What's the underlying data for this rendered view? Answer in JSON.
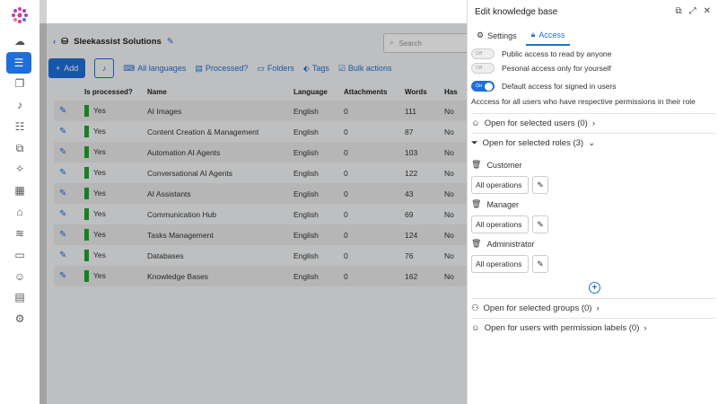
{
  "sidebar": {
    "items": [
      {
        "icon": "brain-icon"
      },
      {
        "icon": "database-icon"
      },
      {
        "icon": "gallery-icon"
      },
      {
        "icon": "microphone-icon"
      },
      {
        "icon": "checklist-icon"
      },
      {
        "icon": "copy-icon"
      },
      {
        "icon": "sparkle-icon"
      },
      {
        "icon": "chart-icon"
      },
      {
        "icon": "bank-icon"
      },
      {
        "icon": "stack-icon"
      },
      {
        "icon": "chat-icon"
      },
      {
        "icon": "users-icon"
      },
      {
        "icon": "server-icon"
      },
      {
        "icon": "gear-icon"
      }
    ]
  },
  "header": {
    "breadcrumb": "Sleekassist Solutions",
    "search_placeholder": "Search"
  },
  "toolbar": {
    "add_label": "Add",
    "all_languages": "All languages",
    "processed": "Processed?",
    "folders": "Folders",
    "tags": "Tags",
    "bulk_actions": "Bulk actions"
  },
  "table": {
    "columns": [
      "",
      "Is processed?",
      "Name",
      "Language",
      "Attachments",
      "Words",
      "Has"
    ],
    "rows": [
      {
        "processed": "Yes",
        "name": "AI Images",
        "language": "English",
        "attachments": "0",
        "words": "111",
        "has": "No"
      },
      {
        "processed": "Yes",
        "name": "Content Creation & Management",
        "language": "English",
        "attachments": "0",
        "words": "87",
        "has": "No"
      },
      {
        "processed": "Yes",
        "name": "Automation AI Agents",
        "language": "English",
        "attachments": "0",
        "words": "103",
        "has": "No"
      },
      {
        "processed": "Yes",
        "name": "Conversational AI Agents",
        "language": "English",
        "attachments": "0",
        "words": "122",
        "has": "No"
      },
      {
        "processed": "Yes",
        "name": "AI Assistants",
        "language": "English",
        "attachments": "0",
        "words": "43",
        "has": "No"
      },
      {
        "processed": "Yes",
        "name": "Communication Hub",
        "language": "English",
        "attachments": "0",
        "words": "69",
        "has": "No"
      },
      {
        "processed": "Yes",
        "name": "Tasks Management",
        "language": "English",
        "attachments": "0",
        "words": "124",
        "has": "No"
      },
      {
        "processed": "Yes",
        "name": "Databases",
        "language": "English",
        "attachments": "0",
        "words": "76",
        "has": "No"
      },
      {
        "processed": "Yes",
        "name": "Knowledge Bases",
        "language": "English",
        "attachments": "0",
        "words": "162",
        "has": "No"
      }
    ]
  },
  "panel": {
    "title": "Edit knowledge base",
    "tabs": [
      {
        "label": "Settings"
      },
      {
        "label": "Access"
      }
    ],
    "public_access": {
      "toggle": "Off",
      "label": "Public access to read by anyone"
    },
    "personal_access": {
      "toggle": "Off",
      "label": "Pesonal access only for yourself"
    },
    "default_access": {
      "toggle": "On",
      "label": "Default access for signed in users"
    },
    "default_note": "Acccess for all users who have respective permissions in their role",
    "selected_users": "Open for selected users (0)",
    "selected_roles": "Open for selected roles (3)",
    "roles": [
      {
        "name": "Customer",
        "ops": "All operations"
      },
      {
        "name": "Manager",
        "ops": "All operations"
      },
      {
        "name": "Administrator",
        "ops": "All operations"
      }
    ],
    "selected_groups": "Open for selected groups (0)",
    "permission_labels": "Open for users with permission labels (0)"
  },
  "colors": {
    "accent": "#1e6fd9",
    "processed": "#1aa62a"
  }
}
